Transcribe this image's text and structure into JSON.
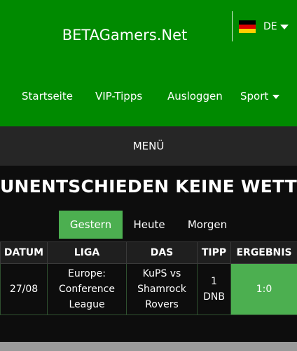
{
  "header": {
    "brand": "BETAGamers.Net",
    "language": {
      "code": "DE",
      "flag_colors": [
        "#000000",
        "#dd0000",
        "#ffce00"
      ]
    },
    "nav": [
      {
        "label": "Startseite"
      },
      {
        "label": "VIP-Tipps"
      },
      {
        "label": "Ausloggen"
      },
      {
        "label": "Sport"
      }
    ]
  },
  "menu": {
    "label": "MENÜ"
  },
  "page": {
    "title": "UNENTSCHIEDEN KEINE WETTE"
  },
  "tabs": [
    {
      "label": "Gestern",
      "active": true
    },
    {
      "label": "Heute",
      "active": false
    },
    {
      "label": "Morgen",
      "active": false
    }
  ],
  "table": {
    "headers": [
      "DATUM",
      "LIGA",
      "DAS",
      "TIPP",
      "ERGEBNIS"
    ],
    "rows": [
      {
        "date": "27/08",
        "league": "Europe: Conference League",
        "match": "KuPS vs Shamrock Rovers",
        "tip": "1 DNB",
        "result": "1:0"
      }
    ]
  },
  "colors": {
    "header_green": "#008a00",
    "accent_green": "#4caf50",
    "menu_bg": "#262626",
    "page_bg": "#0d0d0d"
  }
}
